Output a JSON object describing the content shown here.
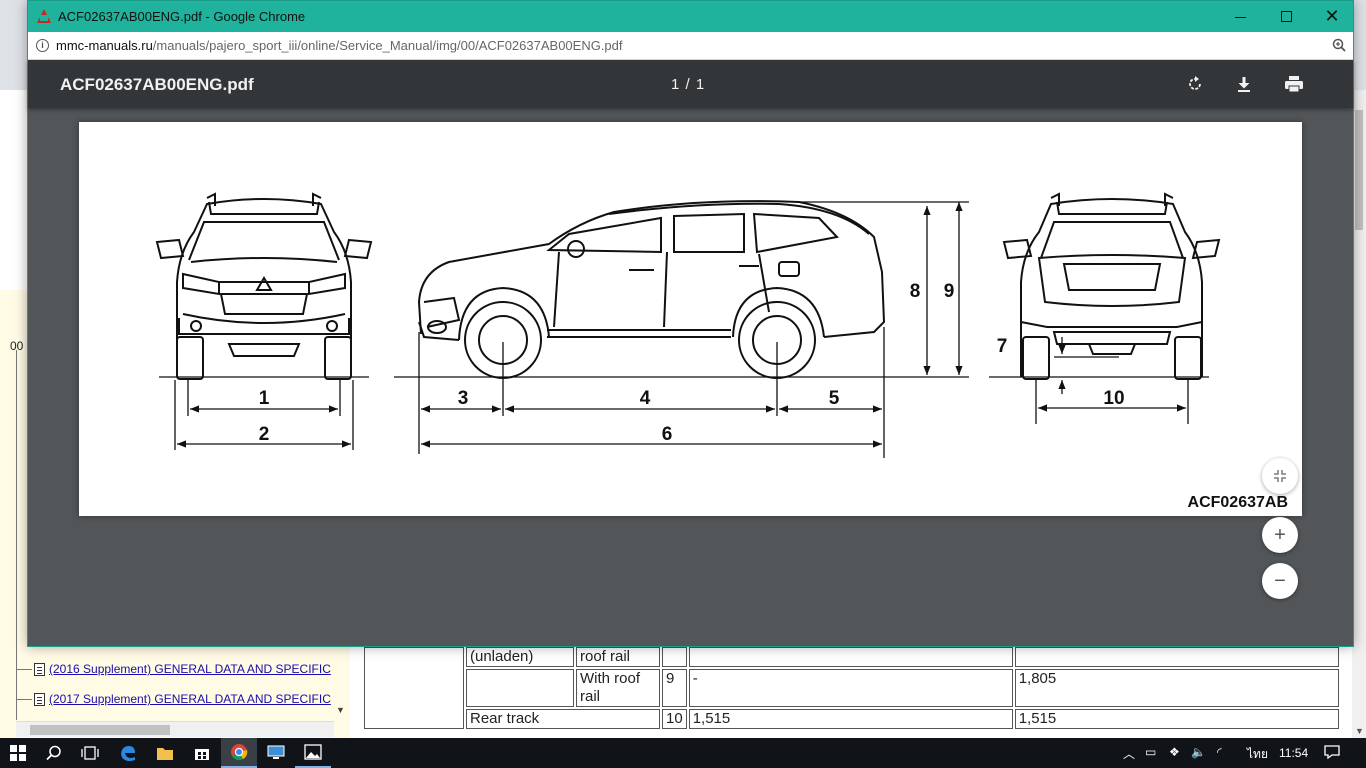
{
  "window": {
    "title": "ACF02637AB00ENG.pdf - Google Chrome",
    "url_host": "mmc-manuals.ru",
    "url_path": "/manuals/pajero_sport_iii/online/Service_Manual/img/00/ACF02637AB00ENG.pdf"
  },
  "pdf": {
    "file_name": "ACF02637AB00ENG.pdf",
    "page_indicator": "1 / 1",
    "figure_code": "ACF02637AB",
    "dimension_labels": {
      "d1": "1",
      "d2": "2",
      "d3": "3",
      "d4": "4",
      "d5": "5",
      "d6": "6",
      "d7": "7",
      "d8": "8",
      "d9": "9",
      "d10": "10"
    }
  },
  "background": {
    "tree_root_label": "00",
    "tree_items": [
      "(2016 Supplement) GENERAL DATA AND SPECIFIC",
      "(2017 Supplement) GENERAL DATA AND SPECIFIC"
    ],
    "table_rows": [
      {
        "c1": "(unladen)",
        "c2": "roof rail",
        "c3": "",
        "c4": "",
        "c5": ""
      },
      {
        "c1": "",
        "c2": "With roof rail",
        "c3": "9",
        "c4": "-",
        "c5": "1,805"
      },
      {
        "c1": "Rear track",
        "c2": "",
        "c3": "10",
        "c4": "1,515",
        "c5": "1,515"
      }
    ]
  },
  "taskbar": {
    "language": "ไทย",
    "time": "11:54"
  },
  "colors": {
    "titlebar": "#1fb39d",
    "pdf_toolbar": "#323639",
    "pdf_background": "#525659"
  }
}
